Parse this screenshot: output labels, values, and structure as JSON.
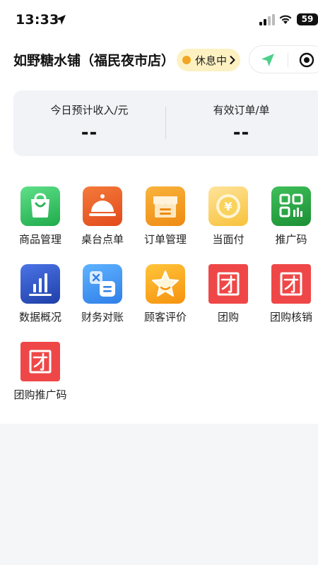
{
  "status_bar": {
    "time": "13:33",
    "battery": "59"
  },
  "header": {
    "shop_name": "如野糖水铺（福民夜市店）",
    "status": "休息中"
  },
  "stats": [
    {
      "label": "今日预计收入/元",
      "value": "--"
    },
    {
      "label": "有效订单/单",
      "value": "--"
    }
  ],
  "menu": [
    {
      "label": "商品管理",
      "icon": "shopping-bag-icon",
      "color": "#2ec25e"
    },
    {
      "label": "桌台点单",
      "icon": "cloche-icon",
      "color": "#ee5a2a"
    },
    {
      "label": "订单管理",
      "icon": "storefront-icon",
      "color": "#f29a1c"
    },
    {
      "label": "当面付",
      "icon": "yuan-coin-icon",
      "color": "#f6c73e"
    },
    {
      "label": "推广码",
      "icon": "qr-code-icon",
      "color": "#1e9a3b"
    },
    {
      "label": "数据概况",
      "icon": "bar-chart-icon",
      "color": "#2f56c8"
    },
    {
      "label": "财务对账",
      "icon": "calculator-icon",
      "color": "#3b8ff0"
    },
    {
      "label": "顾客评价",
      "icon": "star-icon",
      "color": "#f7a51c"
    },
    {
      "label": "团购",
      "icon": "group-buy-icon",
      "color": "#ef4747"
    },
    {
      "label": "团购核销",
      "icon": "group-buy-icon",
      "color": "#ef4747"
    },
    {
      "label": "团购推广码",
      "icon": "group-buy-icon",
      "color": "#ef4747"
    }
  ]
}
